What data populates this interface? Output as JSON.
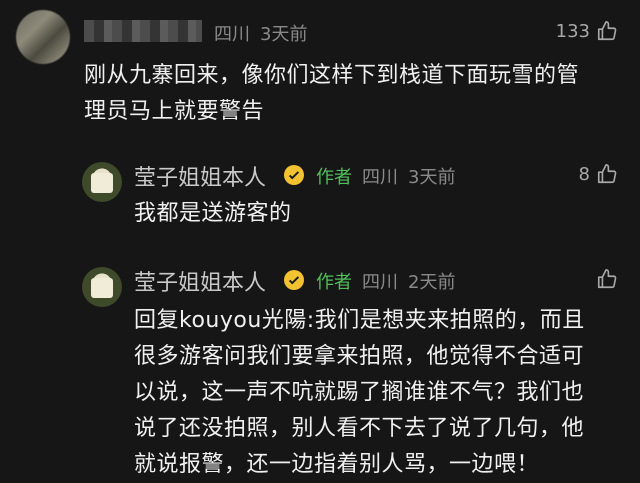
{
  "comment": {
    "location": "四川",
    "time": "3天前",
    "likes": "133",
    "lines": [
      "刚从九寨回来，像你们这样下到栈道下面玩雪的管",
      "理员马上就要警告"
    ]
  },
  "replies": [
    {
      "name": "莹子姐姐本人",
      "author_tag": "作者",
      "location": "四川",
      "time": "3天前",
      "likes": "8",
      "lines": [
        "我都是送游客的"
      ]
    },
    {
      "name": "莹子姐姐本人",
      "author_tag": "作者",
      "location": "四川",
      "time": "2天前",
      "likes": "",
      "lines": [
        "回复kouyou光陽:我们是想夹来拍照的，而且",
        "很多游客问我们要拿来拍照，他觉得不合适可",
        "以说，这一声不吭就踢了搁谁谁不气？我们也",
        "说了还没拍照，别人看不下去了说了几句，他",
        "就说报警，还一边指着别人骂，一边喂！"
      ]
    }
  ],
  "colors": {
    "background": "#161616",
    "author_green": "#4fbf5a",
    "badge_gold": "#f2c230"
  }
}
